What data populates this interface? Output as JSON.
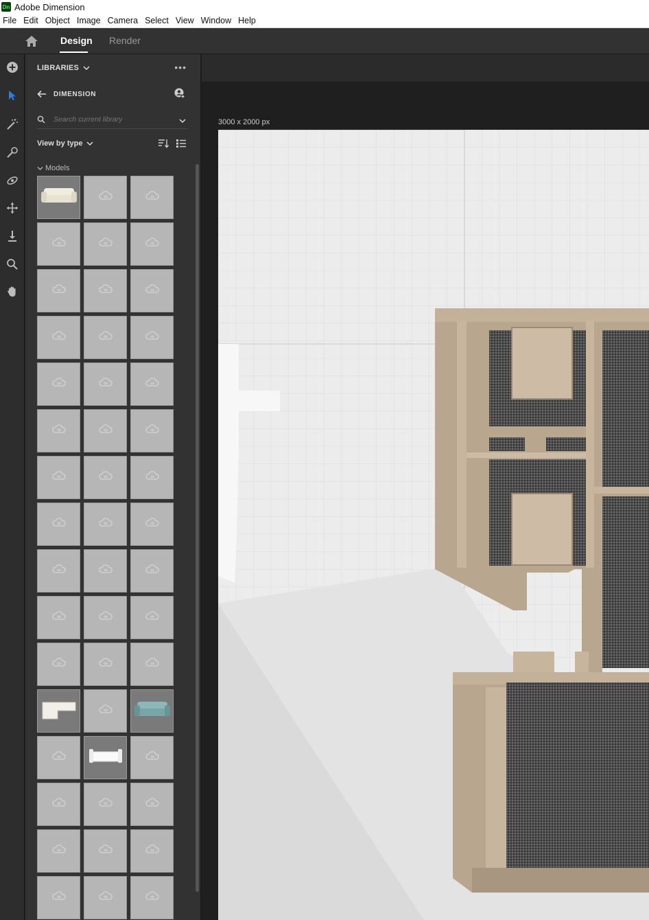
{
  "window": {
    "app_icon": "Dn",
    "title": "Adobe Dimension"
  },
  "menu": [
    "File",
    "Edit",
    "Object",
    "Image",
    "Camera",
    "Select",
    "View",
    "Window",
    "Help"
  ],
  "topbar": {
    "home_icon": "home-icon",
    "tabs": [
      {
        "label": "Design",
        "active": true
      },
      {
        "label": "Render",
        "active": false
      }
    ]
  },
  "tools": [
    "add-icon",
    "select-icon",
    "magic-wand-icon",
    "sample-icon",
    "orbit-icon",
    "pan-move-icon",
    "dolly-icon",
    "zoom-icon",
    "hand-icon"
  ],
  "libraries": {
    "header": "LIBRARIES",
    "library_name": "DIMENSION",
    "search_placeholder": "Search current library",
    "view_by": "View by type",
    "section": "Models",
    "thumbnails_with_image": [
      0,
      33,
      35,
      37
    ],
    "rows": 16,
    "cols": 3
  },
  "canvas": {
    "size_label": "3000 x 2000 px"
  },
  "colors": {
    "accent": "#2680eb",
    "panel": "#323232",
    "canvas": "#eeeeee"
  }
}
